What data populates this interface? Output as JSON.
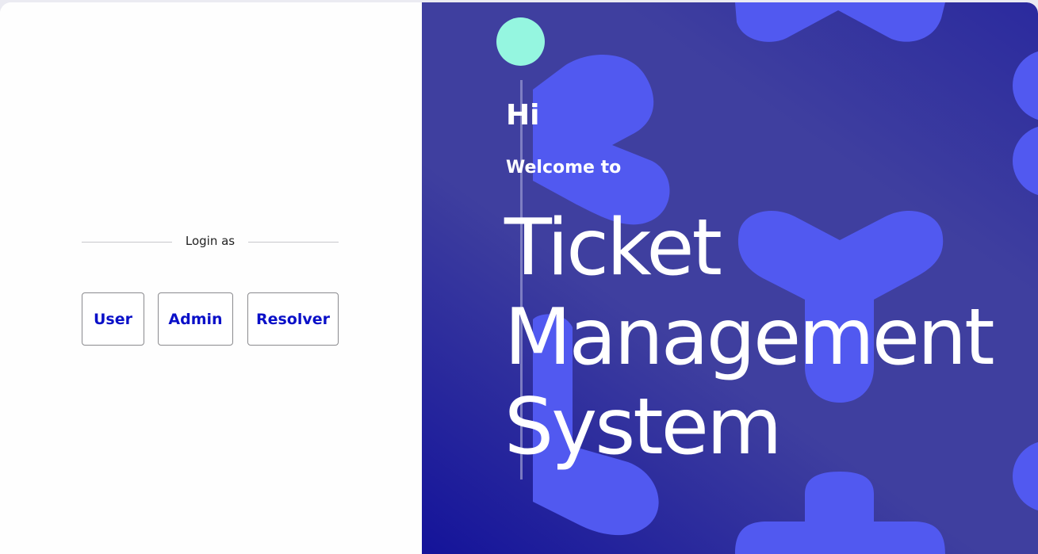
{
  "login": {
    "label": "Login as",
    "buttons": {
      "user": "User",
      "admin": "Admin",
      "resolver": "Resolver"
    }
  },
  "hero": {
    "greeting": "Hi",
    "welcome": "Welcome to",
    "title_lines": [
      "Ticket",
      "Management",
      "System"
    ]
  },
  "colors": {
    "accent": "#0a10c8",
    "panel": "#3f3f9f",
    "shape": "#5159f0",
    "dot": "#95f6e0"
  }
}
